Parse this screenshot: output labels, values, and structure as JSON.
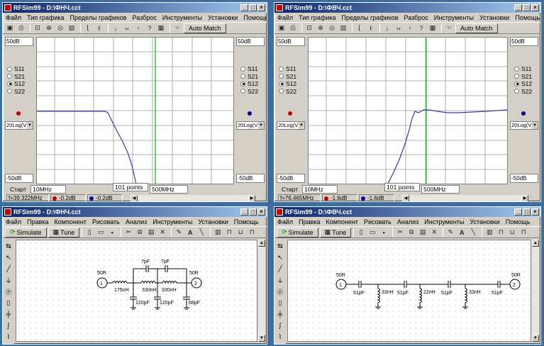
{
  "windows": {
    "tl": {
      "title": "RFSim99 - D:\\ФНЧ.cct",
      "menu": [
        "Файл",
        "Тип графика",
        "Пределы графиков",
        "Разброс",
        "Инструменты",
        "Установки",
        "Помощь"
      ],
      "auto_match": "Auto Match",
      "db_top_left": "50dB",
      "db_bottom_left": "-50dB",
      "db_top_right": "50dB",
      "db_bottom_right": "-50dB",
      "radios": [
        "S11",
        "S21",
        "S12",
        "S22"
      ],
      "selected": "S12",
      "unit": "20Log(V)",
      "start_label": "Старт",
      "start_value": "10MHz",
      "points": "101 points",
      "stop_value": "500MHz",
      "status_freq": "f=39.322MHz",
      "status_red": "-0.2dB",
      "status_blue": "-0.2dB"
    },
    "tr": {
      "title": "RFSim99 - D:\\ФВЧ.cct",
      "menu": [
        "Файл",
        "Тип графика",
        "Пределы графиков",
        "Разброс",
        "Инструменты",
        "Установки",
        "Помощь"
      ],
      "auto_match": "Auto Match",
      "db_top_left": "50dB",
      "db_bottom_left": "-50dB",
      "db_top_right": "50dB",
      "db_bottom_right": "-50dB",
      "radios": [
        "S11",
        "S21",
        "S12",
        "S22"
      ],
      "selected": "S12",
      "unit": "20Log(V)",
      "start_label": "Старт",
      "start_value": "10MHz",
      "points": "101 points",
      "stop_value": "500MHz",
      "status_freq": "f=76.465MHz",
      "status_red": "-1.6dB",
      "status_blue": "-1.6dB"
    },
    "bl": {
      "title": "RFSim99 - D:\\ФНЧ.cct",
      "menu": [
        "Файл",
        "Правка",
        "Компонент",
        "Рисовать",
        "Анализ",
        "Инструменты",
        "Установки",
        "Помощь"
      ],
      "simulate": "Simulate",
      "tune": "Tune",
      "labels": {
        "r1": "50R",
        "r2": "50R",
        "l1": "175nH",
        "l2": "330nH",
        "l3": "330nH",
        "c_top1": "7pF",
        "c_top2": "7pF",
        "c1": "120pF",
        "c2": "120pF",
        "c3": "68pF",
        "port1": "1",
        "port2": "2"
      }
    },
    "br": {
      "title": "RFSim99 - D:\\ФВЧ.cct",
      "menu": [
        "Файл",
        "Правка",
        "Компонент",
        "Рисовать",
        "Анализ",
        "Инструменты",
        "Установки",
        "Помощь"
      ],
      "simulate": "Simulate",
      "tune": "Tune",
      "labels": {
        "r1": "50R",
        "r2": "50R",
        "c1": "51pF",
        "c2": "51pF",
        "c3": "51pF",
        "c4": "51pF",
        "l1": "33nH",
        "l2": "22nH",
        "l3": "33nH",
        "port1": "1",
        "port2": "2"
      }
    }
  },
  "colors": {
    "trace": "#3a3aa8",
    "marker": "#00c000",
    "red_dot": "#c00000",
    "blue_dot": "#0000a0"
  }
}
